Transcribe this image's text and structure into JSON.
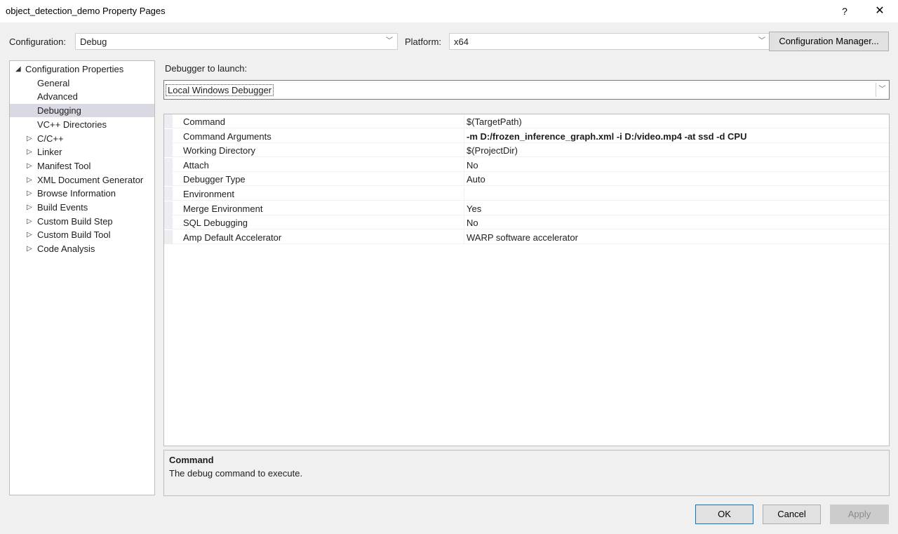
{
  "window": {
    "title": "object_detection_demo Property Pages",
    "help_glyph": "?",
    "close_glyph": "✕"
  },
  "config_bar": {
    "configuration_label": "Configuration:",
    "configuration_value": "Debug",
    "platform_label": "Platform:",
    "platform_value": "x64",
    "config_manager_label": "Configuration Manager..."
  },
  "tree": {
    "items": [
      {
        "label": "Configuration Properties",
        "expander": "◢",
        "level": 0
      },
      {
        "label": "General",
        "expander": "",
        "level": 1
      },
      {
        "label": "Advanced",
        "expander": "",
        "level": 1
      },
      {
        "label": "Debugging",
        "expander": "",
        "level": 1,
        "selected": true
      },
      {
        "label": "VC++ Directories",
        "expander": "",
        "level": 1
      },
      {
        "label": "C/C++",
        "expander": "▷",
        "level": 1
      },
      {
        "label": "Linker",
        "expander": "▷",
        "level": 1
      },
      {
        "label": "Manifest Tool",
        "expander": "▷",
        "level": 1
      },
      {
        "label": "XML Document Generator",
        "expander": "▷",
        "level": 1
      },
      {
        "label": "Browse Information",
        "expander": "▷",
        "level": 1
      },
      {
        "label": "Build Events",
        "expander": "▷",
        "level": 1
      },
      {
        "label": "Custom Build Step",
        "expander": "▷",
        "level": 1
      },
      {
        "label": "Custom Build Tool",
        "expander": "▷",
        "level": 1
      },
      {
        "label": "Code Analysis",
        "expander": "▷",
        "level": 1
      }
    ]
  },
  "debugger": {
    "launch_label": "Debugger to launch:",
    "selected": "Local Windows Debugger"
  },
  "properties": [
    {
      "name": "Command",
      "value": "$(TargetPath)",
      "bold": false
    },
    {
      "name": "Command Arguments",
      "value": "-m D:/frozen_inference_graph.xml -i D:/video.mp4 -at ssd -d CPU",
      "bold": true
    },
    {
      "name": "Working Directory",
      "value": "$(ProjectDir)",
      "bold": false
    },
    {
      "name": "Attach",
      "value": "No",
      "bold": false
    },
    {
      "name": "Debugger Type",
      "value": "Auto",
      "bold": false
    },
    {
      "name": "Environment",
      "value": "",
      "bold": false
    },
    {
      "name": "Merge Environment",
      "value": "Yes",
      "bold": false
    },
    {
      "name": "SQL Debugging",
      "value": "No",
      "bold": false
    },
    {
      "name": "Amp Default Accelerator",
      "value": "WARP software accelerator",
      "bold": false
    }
  ],
  "description": {
    "title": "Command",
    "text": "The debug command to execute."
  },
  "buttons": {
    "ok": "OK",
    "cancel": "Cancel",
    "apply": "Apply"
  },
  "colors": {
    "accent": "#0078d7",
    "selection": "#d9d9e3"
  }
}
